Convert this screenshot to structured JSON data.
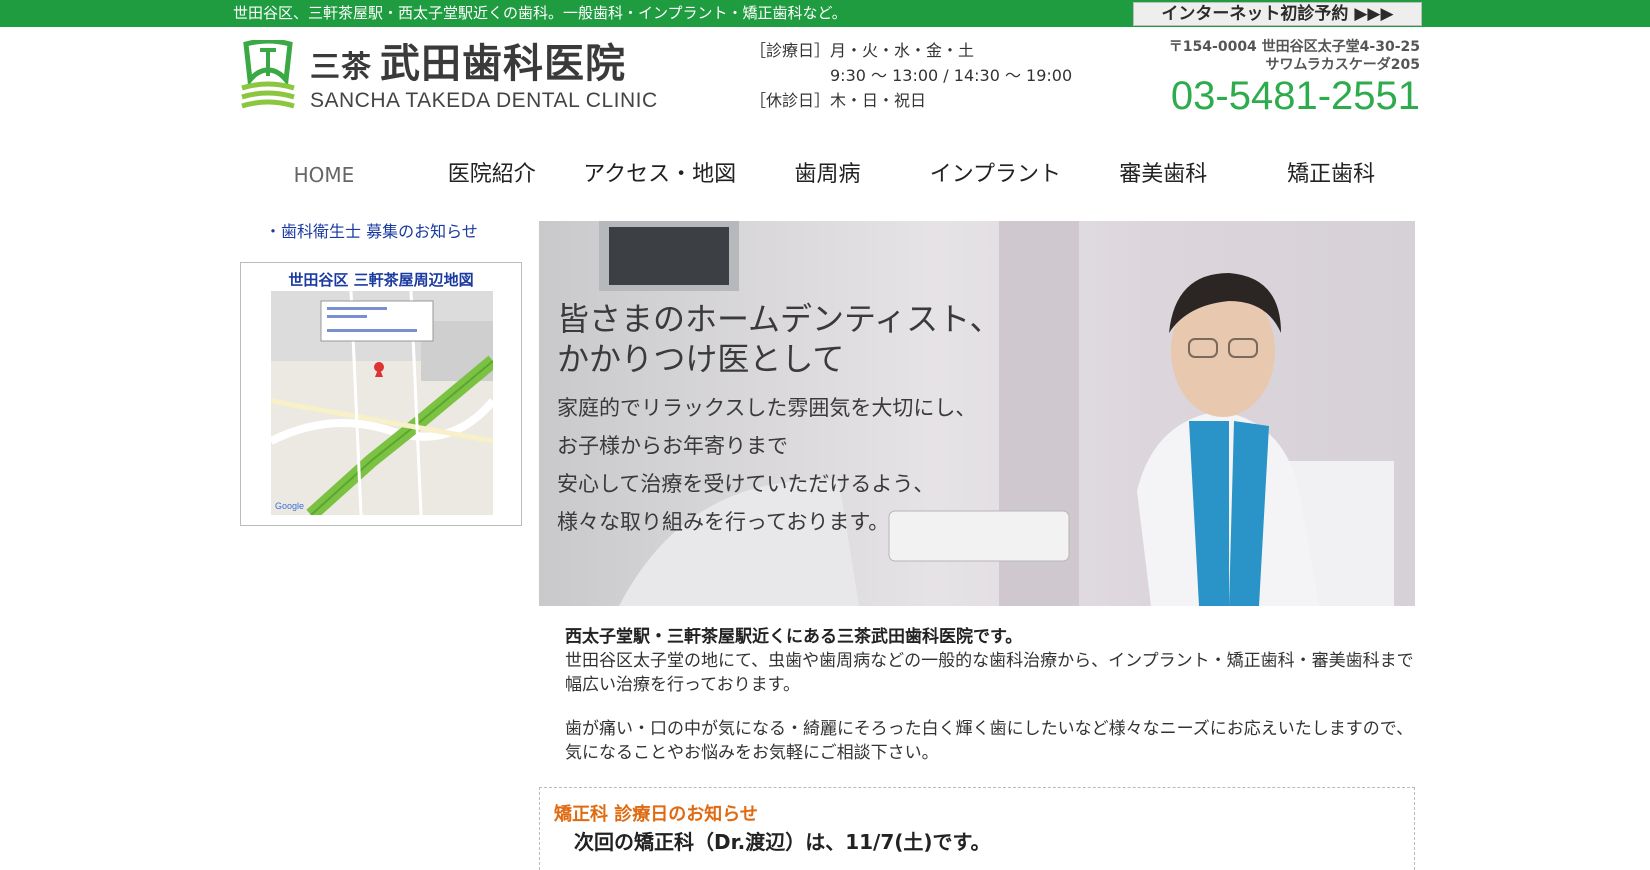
{
  "topbar": {
    "tagline": "世田谷区、三軒茶屋駅・西太子堂駅近くの歯科。一般歯科・インプラント・矯正歯科など。",
    "reserve_label": "インターネット初診予約 ▶▶▶"
  },
  "logo": {
    "prefix": "三茶",
    "name_ja": "武田歯科医院",
    "name_en": "SANCHA TAKEDA DENTAL CLINIC"
  },
  "hours": {
    "days_line": "［診療日］月・火・水・金・土",
    "time_line": "9:30 〜 13:00 / 14:30 〜 19:00",
    "closed_line": "［休診日］木・日・祝日"
  },
  "contact": {
    "address_line1": "〒154-0004 世田谷区太子堂4-30-25",
    "address_line2": "サワムラカスケーダ205",
    "phone": "03-5481-2551"
  },
  "nav": {
    "home": "HOME",
    "about": "医院紹介",
    "access": "アクセス・地図",
    "perio": "歯周病",
    "implant": "インプラント",
    "cosmetic": "審美歯科",
    "ortho": "矯正歯科"
  },
  "sidebar": {
    "recruit": "・歯科衛生士 募集のお知らせ",
    "map_title": "世田谷区 三軒茶屋周辺地図"
  },
  "hero": {
    "headline1": "皆さまのホームデンティスト、",
    "headline2": "かかりつけ医として",
    "line1": "家庭的でリラックスした雰囲気を大切にし、",
    "line2": "お子様からお年寄りまで",
    "line3": "安心して治療を受けていただけるよう、",
    "line4": "様々な取り組みを行っております。"
  },
  "intro": {
    "heading": "西太子堂駅・三軒茶屋駅近くにある三茶武田歯科医院です。",
    "para1": "世田谷区太子堂の地にて、虫歯や歯周病などの一般的な歯科治療から、インプラント・矯正歯科・審美歯科まで幅広い治療を行っております。",
    "para2": "歯が痛い・口の中が気になる・綺麗にそろった白く輝く歯にしたいなど様々なニーズにお応えいたしますので、気になることやお悩みをお気軽にご相談下さい。"
  },
  "notice": {
    "title": "矯正科 診療日のお知らせ",
    "body": "次回の矯正科（Dr.渡辺）は、11/7(土)です。"
  },
  "colors": {
    "brand_green": "#1e9c3f",
    "phone_green": "#2eab4d",
    "link_blue": "#1a3aa0",
    "notice_orange": "#e06a10"
  }
}
